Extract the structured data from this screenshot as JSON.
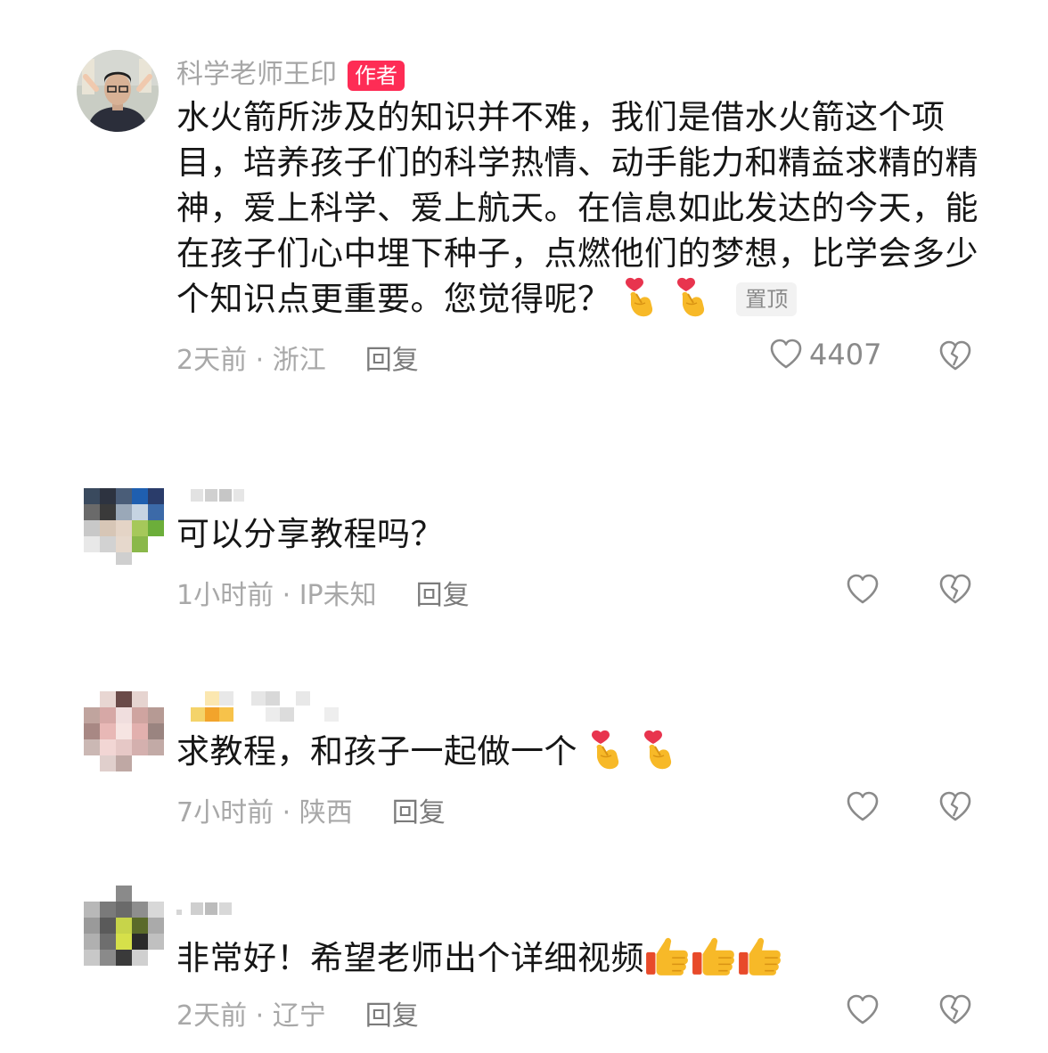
{
  "comments": [
    {
      "author": "科学老师王印",
      "badge": "作者",
      "text": "水火箭所涉及的知识并不难，我们是借水火箭这个项目，培养孩子们的科学热情、动手能力和精益求精的精神，爱上科学、爱上航天。在信息如此发达的今天，能在孩子们心中埋下种子，点燃他们的梦想，比学会多少个知识点更重要。您觉得呢？",
      "emojis": [
        "heart-finger-emoji",
        "heart-finger-emoji"
      ],
      "pinned_label": "置顶",
      "meta": "2天前 · 浙江",
      "reply_label": "回复",
      "likes": "4407"
    },
    {
      "author": "",
      "text": "可以分享教程吗？",
      "meta": "1小时前 · IP未知",
      "reply_label": "回复"
    },
    {
      "author": "",
      "text": "求教程，和孩子一起做一个",
      "emojis": [
        "heart-finger-emoji",
        "heart-finger-emoji"
      ],
      "meta": "7小时前 · 陕西",
      "reply_label": "回复"
    },
    {
      "author": "",
      "text": "非常好！希望老师出个详细视频",
      "emojis": [
        "thumbs-up-emoji",
        "thumbs-up-emoji",
        "thumbs-up-emoji"
      ],
      "meta": "2天前 · 辽宁",
      "reply_label": "回复"
    }
  ],
  "colors": {
    "author_badge": "#fe2c55",
    "meta_text": "#a8a8a8",
    "pin_badge_bg": "#f2f2f2"
  }
}
